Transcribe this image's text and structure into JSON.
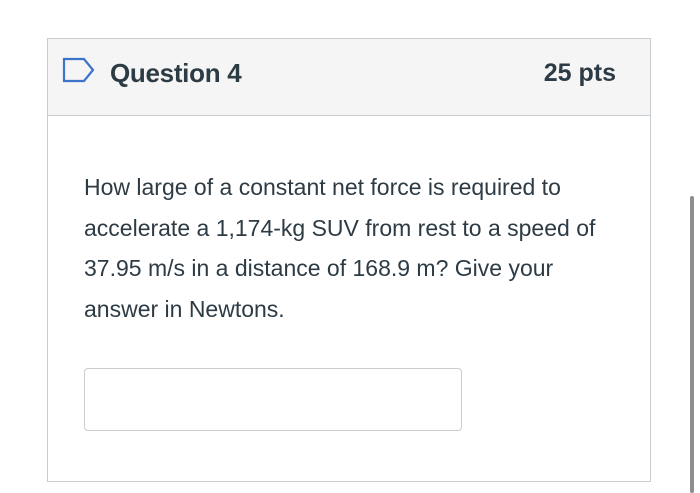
{
  "question": {
    "title": "Question 4",
    "points": "25 pts",
    "flag_icon": "bookmark-flag-outline-icon",
    "text": "How large of a constant net force is required to accelerate a 1,174-kg SUV from rest to a speed of 37.95 m/s in a distance of 168.9 m?  Give your answer in Newtons.",
    "answer": {
      "value": "",
      "placeholder": ""
    }
  },
  "colors": {
    "header_bg": "#f5f5f5",
    "border": "#c7cdd1",
    "text": "#2d3b45",
    "flag": "#3b73c8"
  }
}
